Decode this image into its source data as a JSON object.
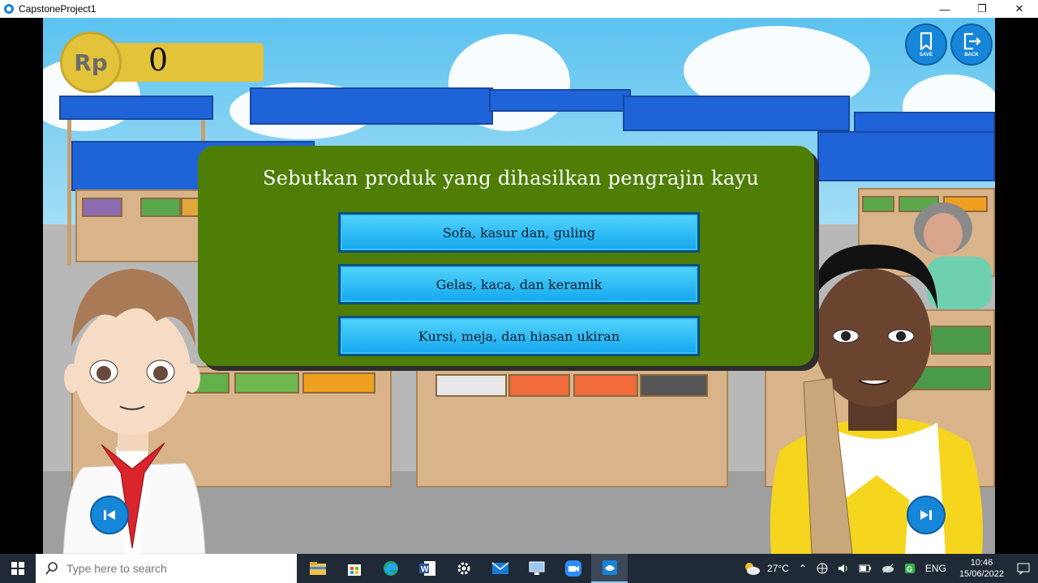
{
  "window": {
    "title": "CapstoneProject1"
  },
  "game": {
    "money": {
      "symbol": "Rp",
      "value": "0"
    },
    "save_label": "SAVE",
    "back_label": "BACK",
    "question": "Sebutkan produk yang dihasilkan pengrajin kayu",
    "answers": [
      "Sofa, kasur dan, guling",
      "Gelas, kaca, dan keramik",
      "Kursi, meja, dan hiasan ukiran"
    ]
  },
  "taskbar": {
    "search_placeholder": "Type here to search",
    "weather": "27°C",
    "language": "ENG",
    "time": "10:46",
    "date": "15/06/2022"
  },
  "colors": {
    "panel": "#4e7e06",
    "answer_button": "#1aaef2",
    "money": "#e3c33a",
    "round_button": "#1686d9"
  }
}
